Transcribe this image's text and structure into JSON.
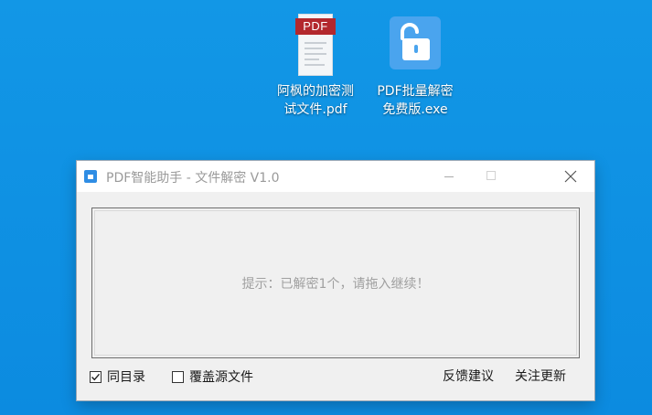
{
  "desktop": {
    "icons": [
      {
        "name": "pdf-document",
        "badge": "PDF",
        "caption_lines": [
          "阿枫的加密测",
          "试文件.pdf"
        ]
      },
      {
        "name": "unlock-app",
        "caption_lines": [
          "PDF批量解密",
          "免费版.exe"
        ]
      }
    ]
  },
  "window": {
    "title": "PDF智能助手 - 文件解密 V1.0",
    "drop_area": {
      "hint": "提示：已解密1个，请拖入继续！"
    },
    "options": {
      "same_dir": {
        "label": "同目录",
        "checked": true
      },
      "overwrite": {
        "label": "覆盖源文件",
        "checked": false
      }
    },
    "links": {
      "feedback": "反馈建议",
      "follow": "关注更新"
    }
  },
  "colors": {
    "desktop": "#0f8ee0",
    "pdf_band": "#b3282d",
    "lock_app": "#4aa4ee",
    "app_icon": "#2f8de4"
  }
}
